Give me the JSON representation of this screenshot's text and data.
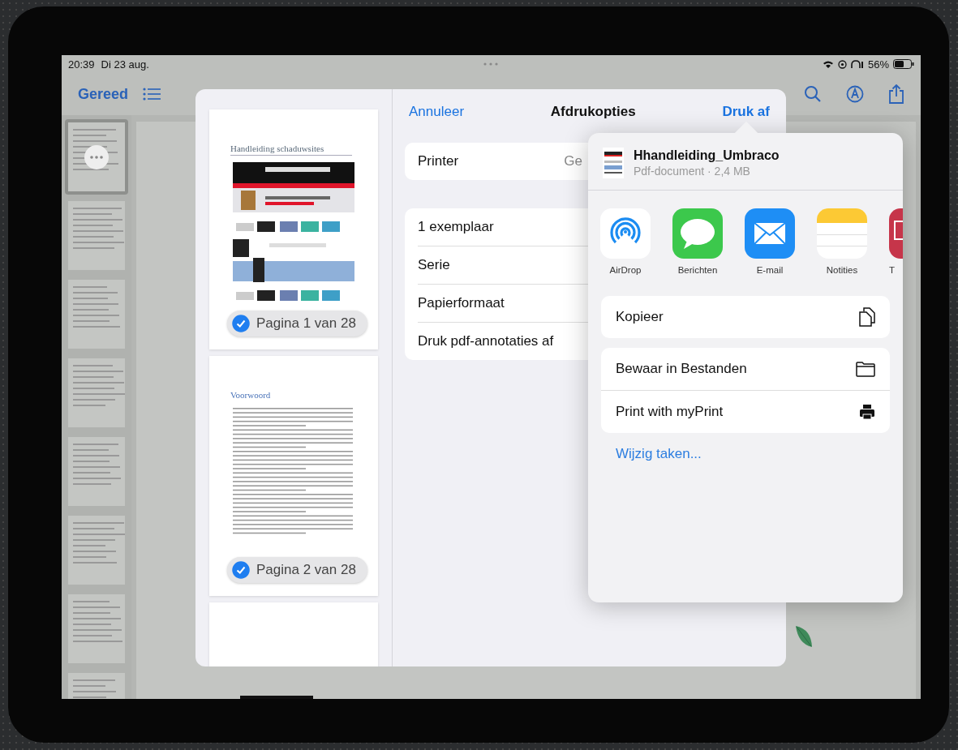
{
  "status_bar": {
    "time": "20:39",
    "date": "Di 23 aug.",
    "battery": "56%"
  },
  "toolbar": {
    "done": "Gereed"
  },
  "sidebar": {
    "thumbnails": [
      {
        "selected": true
      },
      {
        "selected": false
      },
      {
        "selected": false
      },
      {
        "selected": false
      },
      {
        "selected": false
      },
      {
        "selected": false
      },
      {
        "selected": false
      },
      {
        "selected": false
      }
    ]
  },
  "print_dialog": {
    "cancel": "Annuleer",
    "title": "Afdrukopties",
    "print": "Druk af",
    "printer": {
      "label": "Printer",
      "value": "Ge"
    },
    "options": [
      "1 exemplaar",
      "Serie",
      "Papierformaat",
      "Druk pdf-annotaties af"
    ],
    "pages": [
      {
        "kind": "web",
        "heading": "Handleiding schaduwsites",
        "label": "Pagina 1 van 28",
        "selected": true
      },
      {
        "kind": "text",
        "heading": "Voorwoord",
        "label": "Pagina 2 van 28",
        "selected": true
      },
      {
        "kind": "blank"
      }
    ]
  },
  "share_sheet": {
    "file_name": "Hhandleiding_Umbraco",
    "file_info": "Pdf-document · 2,4 MB",
    "apps": [
      {
        "kind": "airdrop",
        "label": "AirDrop"
      },
      {
        "kind": "messages",
        "label": "Berichten"
      },
      {
        "kind": "mail",
        "label": "E-mail"
      },
      {
        "kind": "notes",
        "label": "Notities"
      },
      {
        "kind": "partial",
        "label": "T"
      }
    ],
    "action_groups": [
      [
        {
          "kind": "copy",
          "label": "Kopieer"
        }
      ],
      [
        {
          "kind": "folder",
          "label": "Bewaar in Bestanden"
        },
        {
          "kind": "printer",
          "label": "Print with myPrint"
        }
      ]
    ],
    "edit_actions": "Wijzig taken..."
  }
}
